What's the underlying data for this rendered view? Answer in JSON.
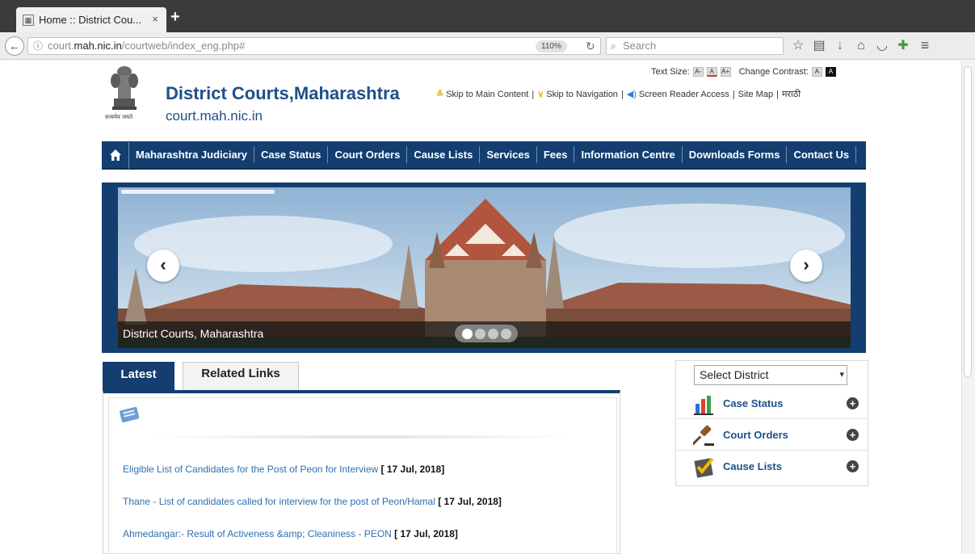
{
  "browser": {
    "tab_title": "Home :: District Cou...",
    "tab_close": "×",
    "new_tab": "+",
    "url_prefix": "court.",
    "url_host": "mah.nic.in",
    "url_path": "/courtweb/index_eng.php#",
    "zoom": "110%",
    "search_placeholder": "Search"
  },
  "header": {
    "emblem_caption": "सत्यमेव जयते",
    "title": "District Courts,Maharashtra",
    "subtitle": "court.mah.nic.in",
    "text_size_label": "Text Size:",
    "text_size_options": [
      "A-",
      "A",
      "A+"
    ],
    "contrast_label": "Change Contrast:",
    "contrast_options": [
      "A",
      "A"
    ],
    "skip_main": "Skip to Main Content",
    "skip_nav": "Skip to Navigation",
    "screen_reader": "Screen Reader Access",
    "site_map": "Site Map",
    "marathi": "मराठी",
    "separator": "|"
  },
  "nav": {
    "items": [
      "Maharashtra Judiciary",
      "Case Status",
      "Court Orders",
      "Cause Lists",
      "Services",
      "Fees",
      "Information Centre",
      "Downloads Forms",
      "Contact Us"
    ]
  },
  "banner": {
    "caption": "District Courts, Maharashtra",
    "prev": "‹",
    "next": "›",
    "slide_count": 4,
    "active_slide": 1
  },
  "tabs": {
    "latest": "Latest",
    "related": "Related Links"
  },
  "news": [
    {
      "text": "Eligible List of Candidates for the Post of Peon for Interview",
      "date": "[ 17 Jul, 2018]"
    },
    {
      "text": "Thane - List of candidates called for interview for the post of Peon/Hamal",
      "date": "[ 17 Jul, 2018]"
    },
    {
      "text": "Ahmedangar:- Result of Activeness &amp; Cleaniness - PEON",
      "date": "[ 17 Jul, 2018]"
    }
  ],
  "sidebar": {
    "select_value": "Select District",
    "items": [
      {
        "label": "Case Status",
        "icon": "bar-chart-icon"
      },
      {
        "label": "Court Orders",
        "icon": "gavel-icon"
      },
      {
        "label": "Cause Lists",
        "icon": "checklist-icon"
      }
    ],
    "expand": "+"
  },
  "colors": {
    "nav_bg": "#133e6f",
    "title": "#1f4f8a",
    "link": "#2f6fae",
    "skip_chevron": "#e6b100"
  }
}
